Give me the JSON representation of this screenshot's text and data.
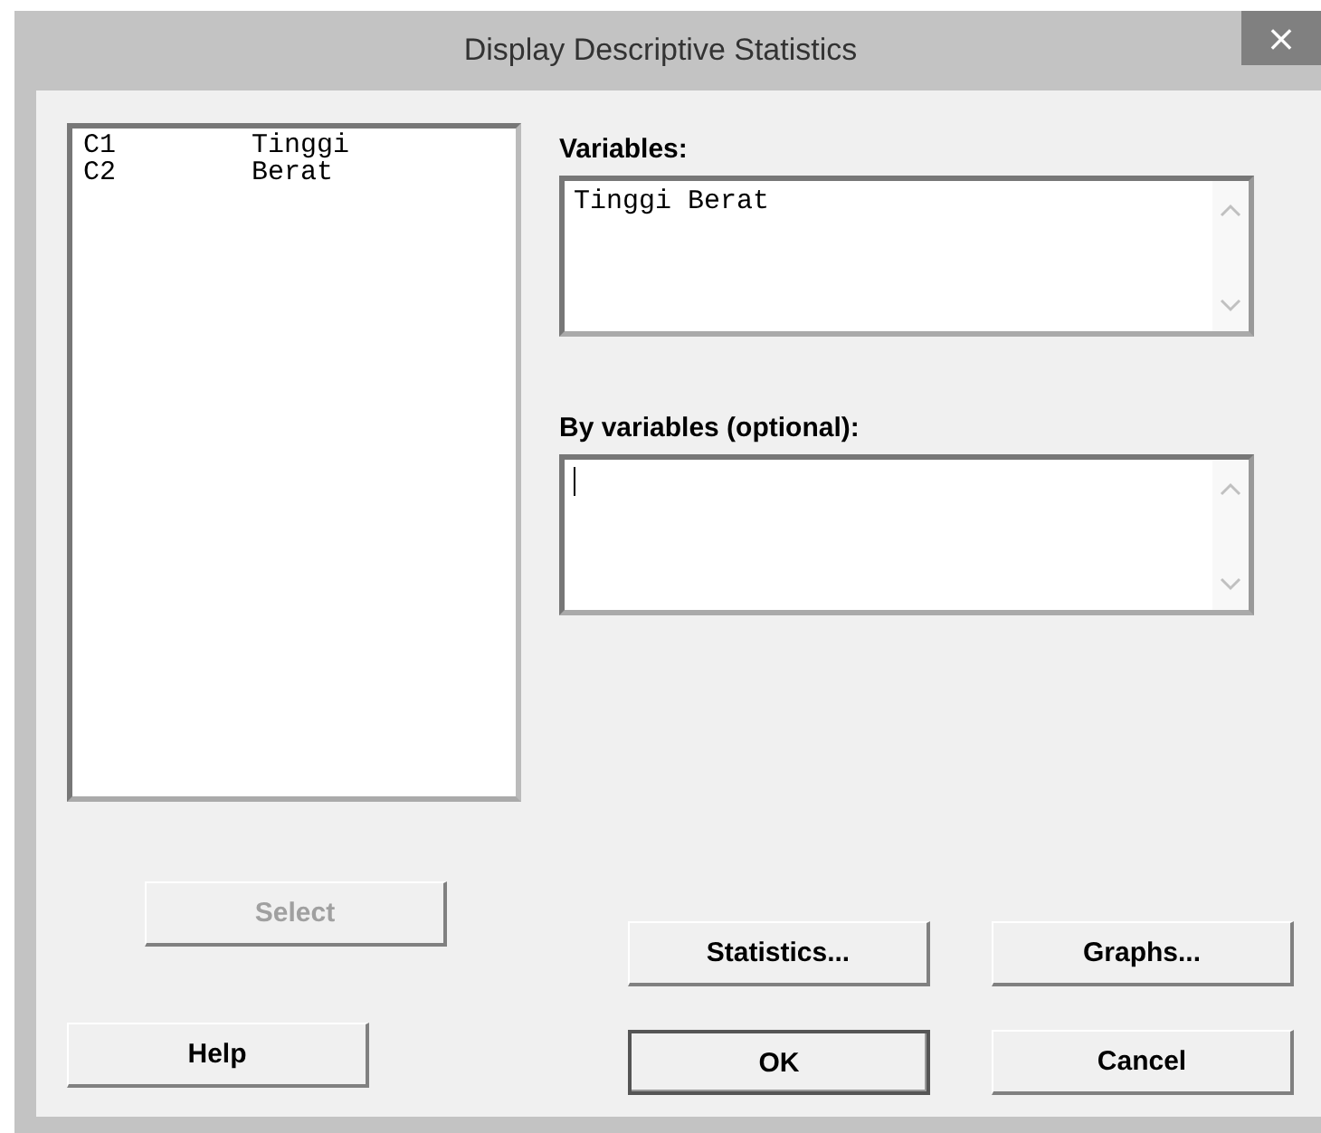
{
  "window": {
    "title": "Display Descriptive Statistics",
    "close": "×"
  },
  "column_list": {
    "items": [
      {
        "column": "C1",
        "name": "Tinggi"
      },
      {
        "column": "C2",
        "name": "Berat"
      }
    ]
  },
  "variables": {
    "label": "Variables:",
    "value": "Tinggi Berat"
  },
  "by_variables": {
    "label": "By variables (optional):",
    "focused": true
  },
  "buttons": [
    {
      "kind": "select",
      "label": "Select",
      "disabled": true,
      "default": false
    },
    {
      "kind": "statistics",
      "label": "Statistics...",
      "disabled": false,
      "default": false
    },
    {
      "kind": "graphs",
      "label": "Graphs...",
      "disabled": false,
      "default": false
    },
    {
      "kind": "help",
      "label": "Help",
      "disabled": false,
      "default": false
    },
    {
      "kind": "ok",
      "label": "OK",
      "disabled": false,
      "default": true
    },
    {
      "kind": "cancel",
      "label": "Cancel",
      "disabled": false,
      "default": false
    }
  ]
}
